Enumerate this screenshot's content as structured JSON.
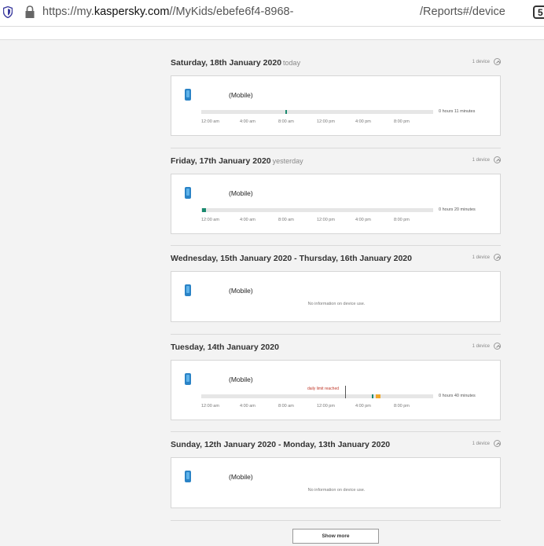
{
  "browser": {
    "url_prefix": "https://my.",
    "url_domain": "kaspersky.com",
    "url_path": "//MyKids/ebefe6f4-8968-",
    "url_tail": "/Reports#/device",
    "tab_count": "5"
  },
  "ticks": [
    "12:00 am",
    "4:00 am",
    "8:00 am",
    "12:00 pm",
    "4:00 pm",
    "8:00 pm"
  ],
  "days": [
    {
      "title": "Saturday, 18th January 2020",
      "relative": "today",
      "device_count": "1 device",
      "device_name": "(Mobile)",
      "total": "0 hours 11 minutes",
      "segments": [
        {
          "start_hour": 8.7,
          "end_hour": 8.9,
          "color": "#1a8a6f"
        }
      ]
    },
    {
      "title": "Friday, 17th January 2020",
      "relative": "yesterday",
      "device_count": "1 device",
      "device_name": "(Mobile)",
      "total": "0 hours 20 minutes",
      "segments": [
        {
          "start_hour": 0.1,
          "end_hour": 0.45,
          "color": "#1a8a6f"
        }
      ]
    },
    {
      "title": "Wednesday, 15th January 2020 - Thursday, 16th January 2020",
      "relative": "",
      "device_count": "1 device",
      "device_name": "(Mobile)",
      "no_info": "No information on device use."
    },
    {
      "title": "Tuesday, 14th January 2020",
      "relative": "",
      "device_count": "1 device",
      "device_name": "(Mobile)",
      "total": "0 hours 40 minutes",
      "limit_label": "daily limit reached",
      "segments": [
        {
          "start_hour": 17.65,
          "end_hour": 17.85,
          "color": "#1a8a6f"
        },
        {
          "start_hour": 18.05,
          "end_hour": 18.55,
          "color": "#f0a82b"
        }
      ]
    },
    {
      "title": "Sunday, 12th January 2020 - Monday, 13th January 2020",
      "relative": "",
      "device_count": "1 device",
      "device_name": "(Mobile)",
      "no_info": "No information on device use."
    }
  ],
  "show_more": "Show more"
}
